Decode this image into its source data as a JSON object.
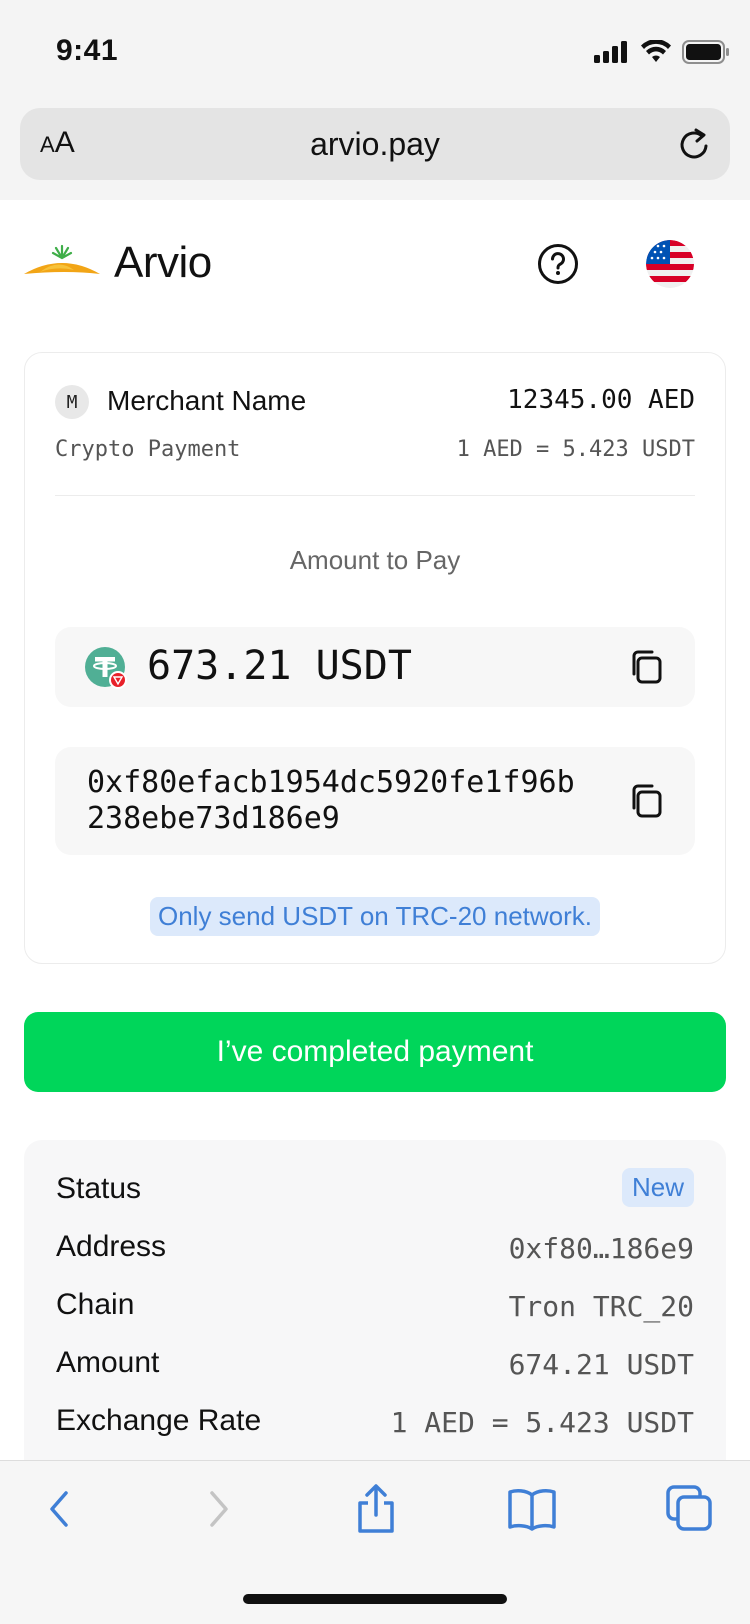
{
  "status_bar": {
    "time": "9:41"
  },
  "browser": {
    "aa_label_small": "A",
    "aa_label_large": "A",
    "url": "arvio.pay"
  },
  "header": {
    "brand": "Arvio"
  },
  "payment": {
    "merchant_initial": "M",
    "merchant_name": "Merchant Name",
    "total": "12345.00 AED",
    "payment_type": "Crypto Payment",
    "rate": "1 AED = 5.423 USDT",
    "amount_label": "Amount to Pay",
    "amount": "673.21 USDT",
    "address": "0xf80efacb1954dc5920fe1f96b238ebe73d186e9",
    "network_note": "Only send USDT on TRC-20 network."
  },
  "cta": {
    "label": "I’ve completed payment"
  },
  "details": {
    "rows": [
      {
        "label": "Status",
        "value": "New"
      },
      {
        "label": "Address",
        "value": "0xf80…186e9"
      },
      {
        "label": "Chain",
        "value": "Tron TRC_20"
      },
      {
        "label": "Amount",
        "value": "674.21 USDT"
      },
      {
        "label": "Exchange Rate",
        "value": "1 AED = 5.423 USDT"
      }
    ]
  },
  "colors": {
    "accent_green": "#00d65a",
    "link_blue": "#3f7fd6",
    "badge_bg": "#dce9fb",
    "tether_green": "#50af95"
  }
}
